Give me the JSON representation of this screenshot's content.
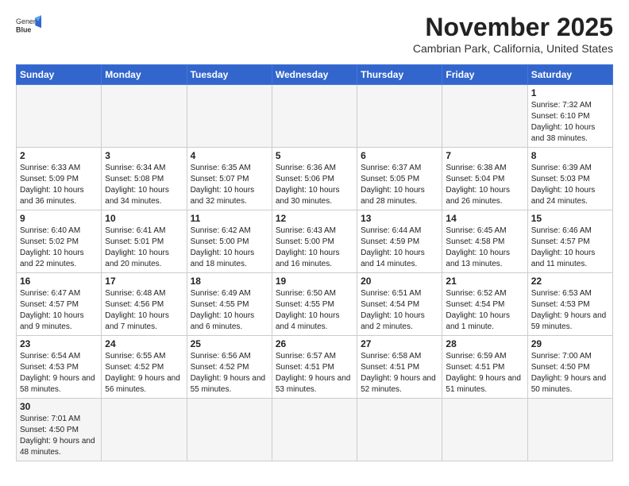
{
  "header": {
    "logo_text_normal": "General",
    "logo_text_bold": "Blue",
    "title": "November 2025",
    "subtitle": "Cambrian Park, California, United States"
  },
  "days_of_week": [
    "Sunday",
    "Monday",
    "Tuesday",
    "Wednesday",
    "Thursday",
    "Friday",
    "Saturday"
  ],
  "weeks": [
    [
      {
        "day": "",
        "info": "",
        "empty": true
      },
      {
        "day": "",
        "info": "",
        "empty": true
      },
      {
        "day": "",
        "info": "",
        "empty": true
      },
      {
        "day": "",
        "info": "",
        "empty": true
      },
      {
        "day": "",
        "info": "",
        "empty": true
      },
      {
        "day": "",
        "info": "",
        "empty": true
      },
      {
        "day": "1",
        "info": "Sunrise: 7:32 AM\nSunset: 6:10 PM\nDaylight: 10 hours and 38 minutes."
      }
    ],
    [
      {
        "day": "2",
        "info": "Sunrise: 6:33 AM\nSunset: 5:09 PM\nDaylight: 10 hours and 36 minutes."
      },
      {
        "day": "3",
        "info": "Sunrise: 6:34 AM\nSunset: 5:08 PM\nDaylight: 10 hours and 34 minutes."
      },
      {
        "day": "4",
        "info": "Sunrise: 6:35 AM\nSunset: 5:07 PM\nDaylight: 10 hours and 32 minutes."
      },
      {
        "day": "5",
        "info": "Sunrise: 6:36 AM\nSunset: 5:06 PM\nDaylight: 10 hours and 30 minutes."
      },
      {
        "day": "6",
        "info": "Sunrise: 6:37 AM\nSunset: 5:05 PM\nDaylight: 10 hours and 28 minutes."
      },
      {
        "day": "7",
        "info": "Sunrise: 6:38 AM\nSunset: 5:04 PM\nDaylight: 10 hours and 26 minutes."
      },
      {
        "day": "8",
        "info": "Sunrise: 6:39 AM\nSunset: 5:03 PM\nDaylight: 10 hours and 24 minutes."
      }
    ],
    [
      {
        "day": "9",
        "info": "Sunrise: 6:40 AM\nSunset: 5:02 PM\nDaylight: 10 hours and 22 minutes."
      },
      {
        "day": "10",
        "info": "Sunrise: 6:41 AM\nSunset: 5:01 PM\nDaylight: 10 hours and 20 minutes."
      },
      {
        "day": "11",
        "info": "Sunrise: 6:42 AM\nSunset: 5:00 PM\nDaylight: 10 hours and 18 minutes."
      },
      {
        "day": "12",
        "info": "Sunrise: 6:43 AM\nSunset: 5:00 PM\nDaylight: 10 hours and 16 minutes."
      },
      {
        "day": "13",
        "info": "Sunrise: 6:44 AM\nSunset: 4:59 PM\nDaylight: 10 hours and 14 minutes."
      },
      {
        "day": "14",
        "info": "Sunrise: 6:45 AM\nSunset: 4:58 PM\nDaylight: 10 hours and 13 minutes."
      },
      {
        "day": "15",
        "info": "Sunrise: 6:46 AM\nSunset: 4:57 PM\nDaylight: 10 hours and 11 minutes."
      }
    ],
    [
      {
        "day": "16",
        "info": "Sunrise: 6:47 AM\nSunset: 4:57 PM\nDaylight: 10 hours and 9 minutes."
      },
      {
        "day": "17",
        "info": "Sunrise: 6:48 AM\nSunset: 4:56 PM\nDaylight: 10 hours and 7 minutes."
      },
      {
        "day": "18",
        "info": "Sunrise: 6:49 AM\nSunset: 4:55 PM\nDaylight: 10 hours and 6 minutes."
      },
      {
        "day": "19",
        "info": "Sunrise: 6:50 AM\nSunset: 4:55 PM\nDaylight: 10 hours and 4 minutes."
      },
      {
        "day": "20",
        "info": "Sunrise: 6:51 AM\nSunset: 4:54 PM\nDaylight: 10 hours and 2 minutes."
      },
      {
        "day": "21",
        "info": "Sunrise: 6:52 AM\nSunset: 4:54 PM\nDaylight: 10 hours and 1 minute."
      },
      {
        "day": "22",
        "info": "Sunrise: 6:53 AM\nSunset: 4:53 PM\nDaylight: 9 hours and 59 minutes."
      }
    ],
    [
      {
        "day": "23",
        "info": "Sunrise: 6:54 AM\nSunset: 4:53 PM\nDaylight: 9 hours and 58 minutes."
      },
      {
        "day": "24",
        "info": "Sunrise: 6:55 AM\nSunset: 4:52 PM\nDaylight: 9 hours and 56 minutes."
      },
      {
        "day": "25",
        "info": "Sunrise: 6:56 AM\nSunset: 4:52 PM\nDaylight: 9 hours and 55 minutes."
      },
      {
        "day": "26",
        "info": "Sunrise: 6:57 AM\nSunset: 4:51 PM\nDaylight: 9 hours and 53 minutes."
      },
      {
        "day": "27",
        "info": "Sunrise: 6:58 AM\nSunset: 4:51 PM\nDaylight: 9 hours and 52 minutes."
      },
      {
        "day": "28",
        "info": "Sunrise: 6:59 AM\nSunset: 4:51 PM\nDaylight: 9 hours and 51 minutes."
      },
      {
        "day": "29",
        "info": "Sunrise: 7:00 AM\nSunset: 4:50 PM\nDaylight: 9 hours and 50 minutes."
      }
    ],
    [
      {
        "day": "30",
        "info": "Sunrise: 7:01 AM\nSunset: 4:50 PM\nDaylight: 9 hours and 48 minutes.",
        "last": true
      },
      {
        "day": "",
        "info": "",
        "empty": true,
        "last": true
      },
      {
        "day": "",
        "info": "",
        "empty": true,
        "last": true
      },
      {
        "day": "",
        "info": "",
        "empty": true,
        "last": true
      },
      {
        "day": "",
        "info": "",
        "empty": true,
        "last": true
      },
      {
        "day": "",
        "info": "",
        "empty": true,
        "last": true
      },
      {
        "day": "",
        "info": "",
        "empty": true,
        "last": true
      }
    ]
  ]
}
